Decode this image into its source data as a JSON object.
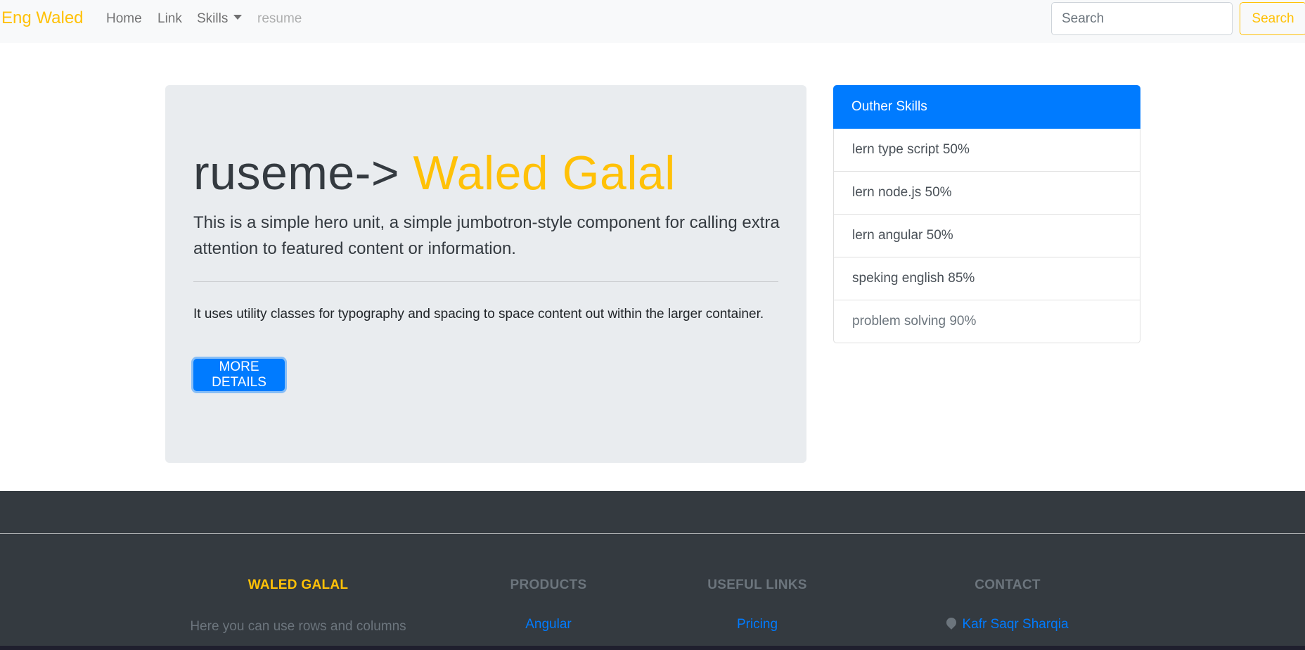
{
  "navbar": {
    "brand": "Eng Waled",
    "links": [
      "Home",
      "Link",
      "Skills",
      "resume"
    ],
    "search_placeholder": "Search",
    "search_button": "Search"
  },
  "hero": {
    "title_prefix": "ruseme-> ",
    "title_name": "Waled Galal",
    "lead": "This is a simple hero unit, a simple jumbotron-style component for calling extra attention to featured content or information.",
    "body": "It uses utility classes for typography and spacing to space content out within the larger container.",
    "button": "MORE DETAILS"
  },
  "skills": {
    "header": "Outher Skills",
    "items": [
      "lern type script 50%",
      "lern node.js 50%",
      "lern angular 50%",
      "speking english 85%",
      "problem solving 90%"
    ]
  },
  "footer": {
    "col1": {
      "heading": "WALED GALAL",
      "text": "Here you can use rows and columns"
    },
    "col2": {
      "heading": "PRODUCTS",
      "link": "Angular"
    },
    "col3": {
      "heading": "USEFUL LINKS",
      "link": "Pricing"
    },
    "col4": {
      "heading": "CONTACT",
      "link": "Kafr Saqr Sharqia"
    }
  },
  "colors": {
    "accent": "#ffc107",
    "primary": "#007bff",
    "footer_bg": "#343a40",
    "jumbotron_bg": "#e9ecef"
  }
}
